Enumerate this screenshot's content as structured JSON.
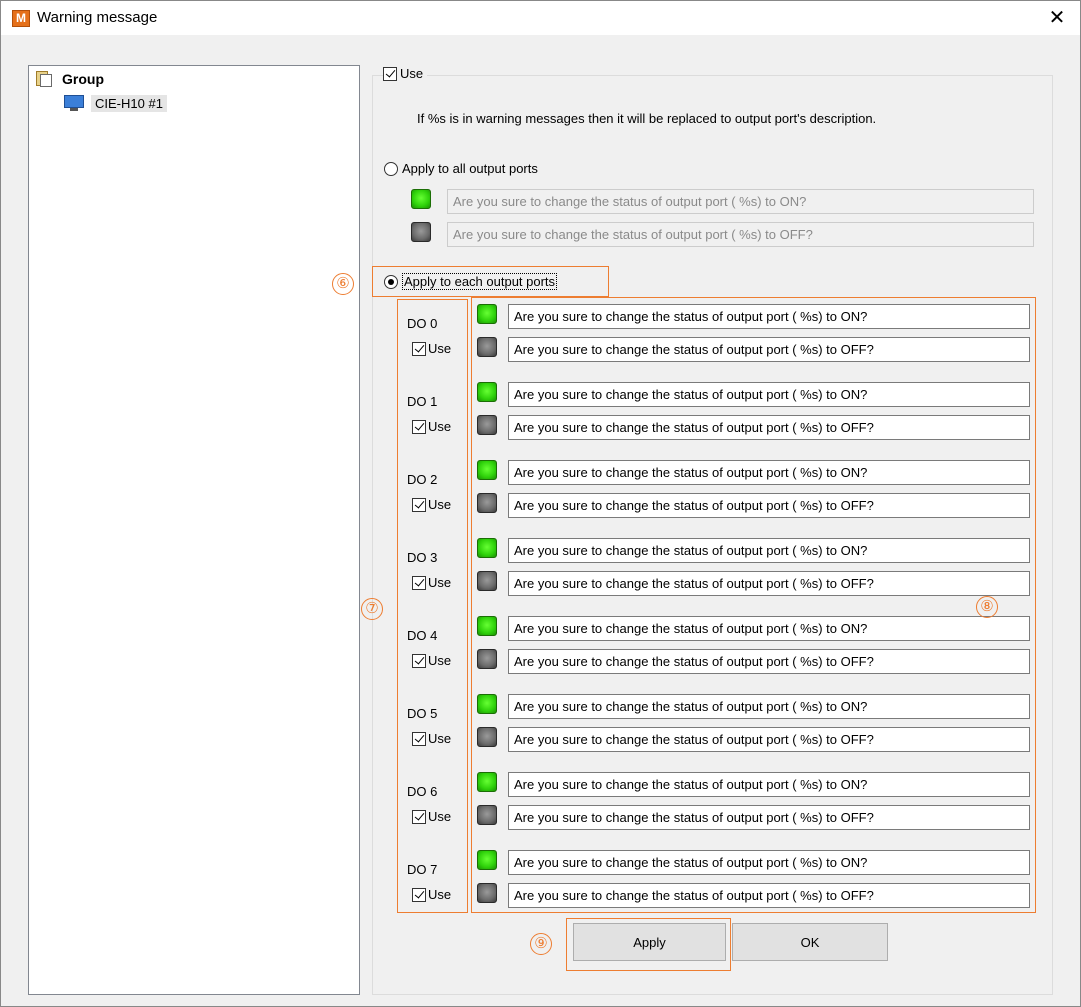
{
  "window": {
    "title": "Warning message",
    "app_icon_letter": "M",
    "close_glyph": "✕"
  },
  "tree": {
    "group_label": "Group",
    "device_label": "CIE-H10 #1"
  },
  "use_label": "Use",
  "info_text": "If %s is in warning messages then it will be replaced to output port's description.",
  "apply_all": {
    "label": "Apply to all output ports",
    "on_message": "Are you sure to change the status of output port ( %s) to ON?",
    "off_message": "Are you sure to change the status of output port ( %s) to OFF?"
  },
  "apply_each": {
    "label": "Apply to each output ports"
  },
  "ports": [
    {
      "name": "DO 0",
      "use": "Use",
      "on": "Are you sure to change the status of output port ( %s) to ON?",
      "off": "Are you sure to change the status of output port ( %s) to OFF?"
    },
    {
      "name": "DO 1",
      "use": "Use",
      "on": "Are you sure to change the status of output port ( %s) to ON?",
      "off": "Are you sure to change the status of output port ( %s) to OFF?"
    },
    {
      "name": "DO 2",
      "use": "Use",
      "on": "Are you sure to change the status of output port ( %s) to ON?",
      "off": "Are you sure to change the status of output port ( %s) to OFF?"
    },
    {
      "name": "DO 3",
      "use": "Use",
      "on": "Are you sure to change the status of output port ( %s) to ON?",
      "off": "Are you sure to change the status of output port ( %s) to OFF?"
    },
    {
      "name": "DO 4",
      "use": "Use",
      "on": "Are you sure to change the status of output port ( %s) to ON?",
      "off": "Are you sure to change the status of output port ( %s) to OFF?"
    },
    {
      "name": "DO 5",
      "use": "Use",
      "on": "Are you sure to change the status of output port ( %s) to ON?",
      "off": "Are you sure to change the status of output port ( %s) to OFF?"
    },
    {
      "name": "DO 6",
      "use": "Use",
      "on": "Are you sure to change the status of output port ( %s) to ON?",
      "off": "Are you sure to change the status of output port ( %s) to OFF?"
    },
    {
      "name": "DO 7",
      "use": "Use",
      "on": "Are you sure to change the status of output port ( %s) to ON?",
      "off": "Are you sure to change the status of output port ( %s) to OFF?"
    }
  ],
  "annotations": {
    "six": "⑥",
    "seven": "⑦",
    "eight": "⑧",
    "nine": "⑨"
  },
  "buttons": {
    "apply": "Apply",
    "ok": "OK"
  },
  "colors": {
    "annotation": "#ed7d31",
    "led_on": "#2ed10a",
    "led_off": "#6b6b6b"
  }
}
